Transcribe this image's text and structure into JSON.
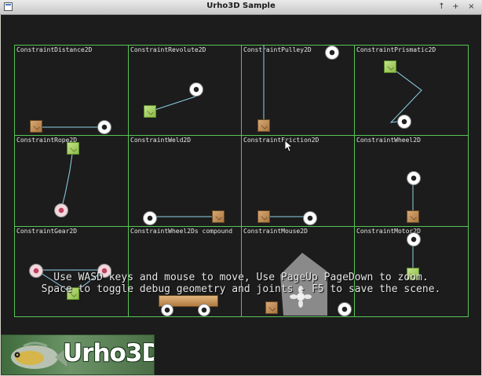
{
  "window": {
    "title": "Urho3D Sample",
    "controls": {
      "pin": "↑",
      "maximize": "+",
      "close": "×"
    }
  },
  "scene": {
    "cells": [
      {
        "label": "ConstraintDistance2D"
      },
      {
        "label": "ConstraintRevolute2D"
      },
      {
        "label": "ConstraintPulley2D"
      },
      {
        "label": "ConstraintPrismatic2D"
      },
      {
        "label": "ConstraintRope2D"
      },
      {
        "label": "ConstraintWeld2D"
      },
      {
        "label": "ConstraintFriction2D"
      },
      {
        "label": "ConstraintWheel2D"
      },
      {
        "label": "ConstraintGear2D"
      },
      {
        "label": "ConstraintWheel2Ds compound"
      },
      {
        "label": "ConstraintMouse2D"
      },
      {
        "label": "ConstraintMotor2D"
      }
    ],
    "instructions": {
      "line1": "Use WASD keys and mouse to move, Use PageUp PageDown to zoom.",
      "line2": "Space to toggle debug geometry and joints - F5 to save the scene."
    }
  },
  "logo": {
    "text": "Urho3D"
  },
  "colors": {
    "grid": "#57c457",
    "background": "#1c1c1c",
    "joint": "#8fd3e8"
  }
}
